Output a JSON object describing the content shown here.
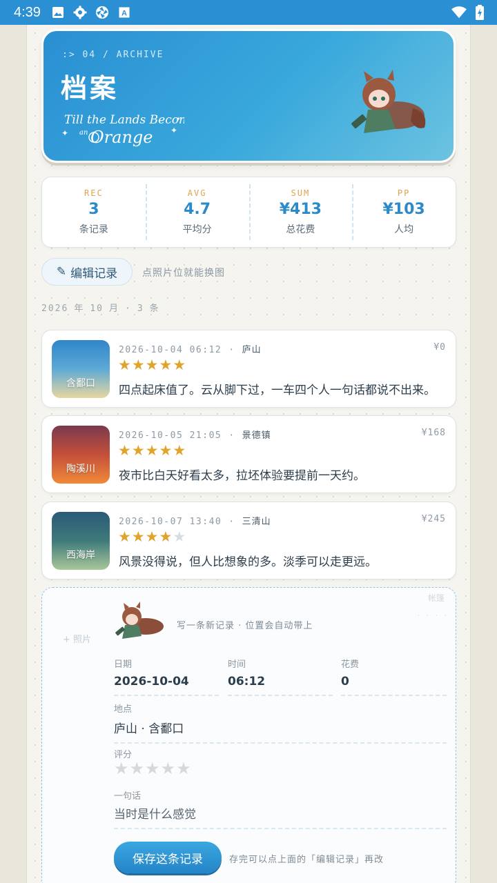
{
  "status_bar": {
    "time": "4:39",
    "icons": [
      "image-icon",
      "settings-gear-icon",
      "aperture-icon",
      "text-a-icon"
    ],
    "right_icons": [
      "wifi-icon",
      "battery-charging-icon"
    ]
  },
  "hero": {
    "crumb": ":> 04 / ARCHIVE",
    "title": "档案",
    "script_text": "Till the Lands Become an Orange"
  },
  "stats": [
    {
      "label": "REC",
      "value": "3",
      "caption": "条记录"
    },
    {
      "label": "AVG",
      "value": "4.7",
      "caption": "平均分"
    },
    {
      "label": "SUM",
      "value": "¥413",
      "caption": "总花费"
    },
    {
      "label": "PP",
      "value": "¥103",
      "caption": "人均"
    }
  ],
  "edit": {
    "icon": "✎",
    "label": "编辑记录",
    "hint": "点照片位就能换图"
  },
  "month_header": {
    "year": "2026",
    "year_unit": "年",
    "month": "10",
    "month_unit": "月",
    "sep": "·",
    "count": "3",
    "count_unit": "条"
  },
  "records": [
    {
      "thumb_label": "含鄱口",
      "datetime": "2026-10-04 06:12",
      "sep": "·",
      "place": "庐山",
      "price": "¥0",
      "rating": 5,
      "note": "四点起床值了。云从脚下过，一车四个人一句话都说不出来。",
      "colors": [
        "#2f86c8",
        "#5ea9d6",
        "#e7d7a0"
      ]
    },
    {
      "thumb_label": "陶溪川",
      "datetime": "2026-10-05 21:05",
      "sep": "·",
      "place": "景德镇",
      "price": "¥168",
      "rating": 5,
      "note": "夜市比白天好看太多，拉坯体验要提前一天约。",
      "colors": [
        "#7a3a4e",
        "#c44f3a",
        "#f08a3a"
      ]
    },
    {
      "thumb_label": "西海岸",
      "datetime": "2026-10-07 13:40",
      "sep": "·",
      "place": "三清山",
      "price": "¥245",
      "rating": 4,
      "note": "风景没得说，但人比想象的多。淡季可以走更远。",
      "colors": [
        "#2a5a78",
        "#3f7a7a",
        "#a9c79a"
      ]
    }
  ],
  "form": {
    "photo_label": "+ 照片",
    "deco_top": "帐篷",
    "deco_mid": "· · · ·",
    "hint": "写一条新记录 · 位置会自动带上",
    "date_label": "日期",
    "date_value": "2026-10-04",
    "time_label": "时间",
    "time_value": "06:12",
    "cost_label": "花费",
    "cost_value": "0",
    "place_label": "地点",
    "place_value": "庐山 · 含鄱口",
    "rating_label": "评分",
    "rating_value": 0,
    "note_label": "一句话",
    "note_placeholder": "当时是什么感觉",
    "save_label": "保存这条记录",
    "save_hint": "存完可以点上面的「编辑记录」再改"
  },
  "colors": {
    "accent": "#2c8ac8",
    "star": "#e0a32c",
    "stat_label": "#e0a34c",
    "statusbar": "#2b8fd3"
  }
}
